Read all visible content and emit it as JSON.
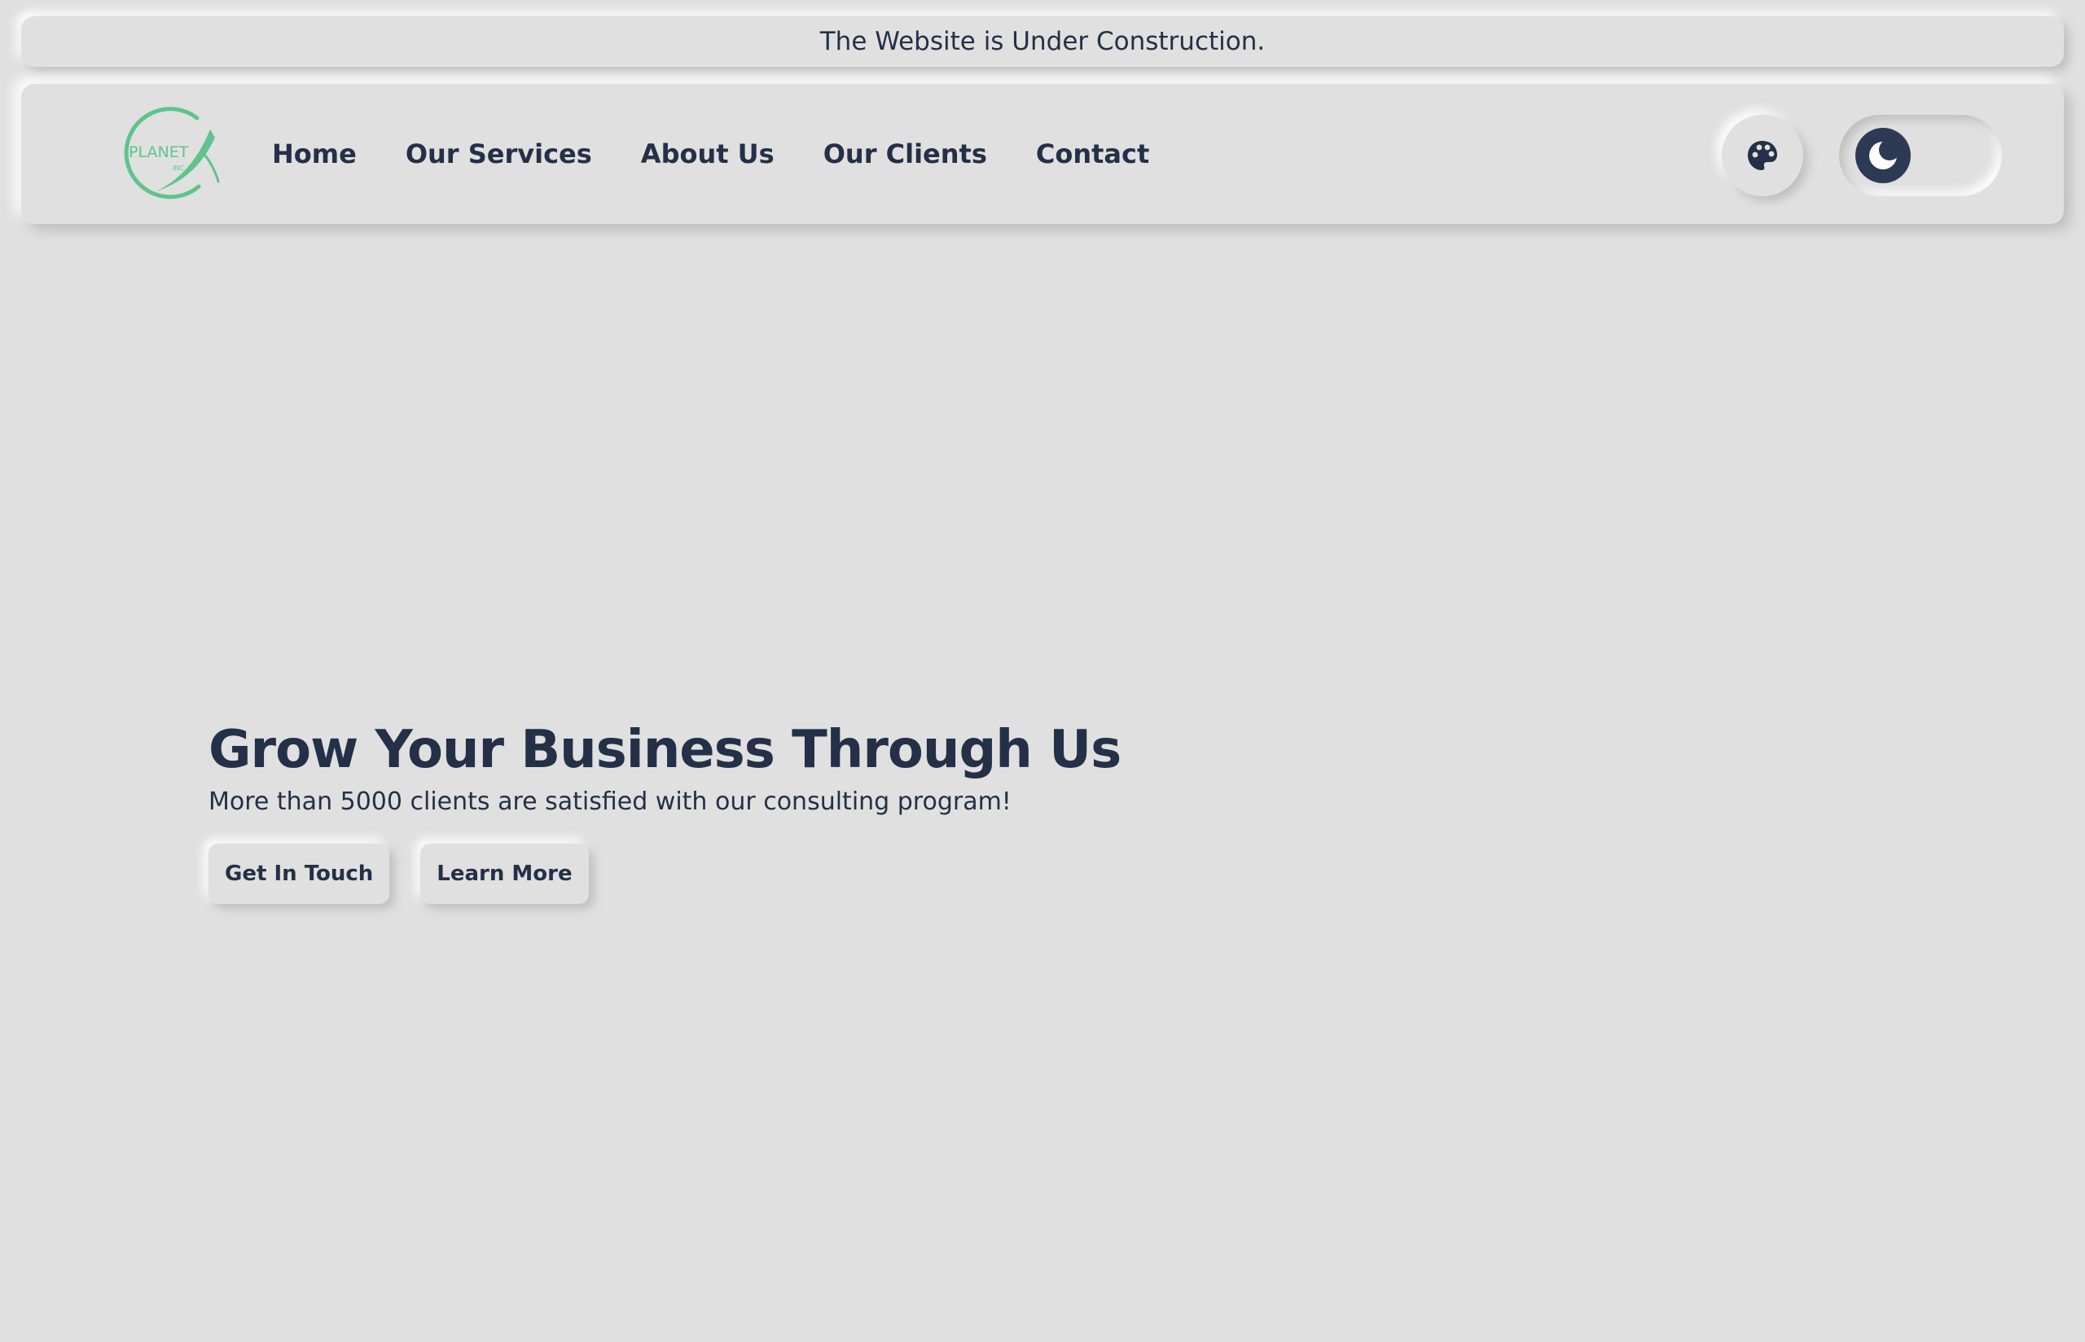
{
  "banner": {
    "text": "The Website is Under Construction."
  },
  "brand": {
    "logo_text": "PLANET",
    "logo_subtext": "INC",
    "logo_color": "#5ec48c"
  },
  "nav": {
    "items": [
      {
        "label": "Home"
      },
      {
        "label": "Our Services"
      },
      {
        "label": "About Us"
      },
      {
        "label": "Our Clients"
      },
      {
        "label": "Contact"
      }
    ]
  },
  "controls": {
    "palette_icon": "palette-icon",
    "theme_icon": "moon-icon",
    "theme_mode": "dark"
  },
  "hero": {
    "title": "Grow Your Business Through Us",
    "subtitle": "More than 5000 clients are satisfied with our consulting program!",
    "primary_button": "Get In Touch",
    "secondary_button": "Learn More"
  },
  "colors": {
    "background": "#e0e0e0",
    "text": "#243047",
    "accent": "#5ec48c"
  }
}
